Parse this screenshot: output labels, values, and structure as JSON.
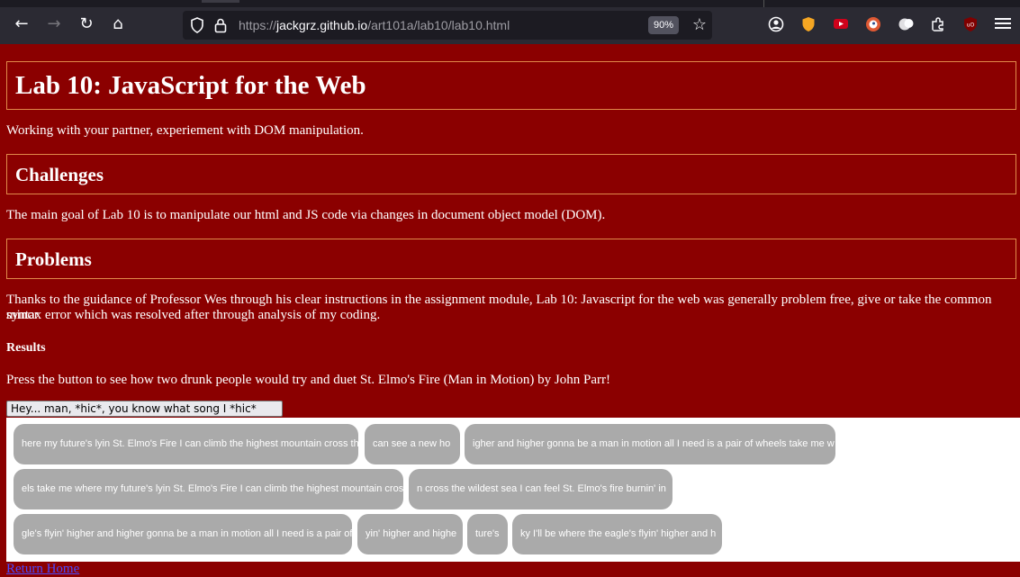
{
  "browser": {
    "url_prefix": "https://",
    "url_host": "jackgrz.github.io",
    "url_path": "/art101a/lab10/lab10.html",
    "zoom": "90%",
    "nav_icons": [
      "back-arrow-icon",
      "forward-arrow-icon",
      "reload-icon",
      "home-icon"
    ],
    "extension_colors": {
      "shield": "#f5a623",
      "youtube": "#d0021b",
      "duckduckgo": "#de5833",
      "ublock": "#800000"
    }
  },
  "page": {
    "title": "Lab 10: JavaScript for the Web",
    "intro": "Working with your partner, experiement with DOM manipulation.",
    "challenges_heading": "Challenges",
    "challenges_text": "The main goal of Lab 10 is to manipulate our html and JS code via changes in document object model (DOM).",
    "problems_heading": "Problems",
    "problems_text_line1": "Thanks to the guidance of Professor Wes through his clear instructions in the assignment module, Lab 10: Javascript for the web was generally problem free, give or take the common minor",
    "problems_text_line2": "syntax error which was resolved after through analysis of my coding.",
    "results_heading": "Results",
    "results_text": "Press the button to see how two drunk people would try and duet St. Elmo's Fire (Man in Motion) by John Parr!",
    "button_label": "Hey... man, *hic*, you know what song I *hic* love...",
    "lyric_chips": [
      "here my future's lyin St. Elmo's Fire I can climb the highest mountain cross th",
      "can see a new ho",
      "igher and higher gonna be a man in motion all I need is a pair of wheels take me w",
      "els take me where my future's lyin St. Elmo's Fire I can climb the highest mountain cros",
      "n cross the wildest sea I can feel St. Elmo's fire burnin' in",
      "gle's flyin' higher and higher gonna be a man in motion all I need is a pair of",
      "yin' higher and highe",
      "ture's",
      "ky I'll be where the eagle's flyin' higher and h"
    ],
    "return_link": "Return Home"
  }
}
